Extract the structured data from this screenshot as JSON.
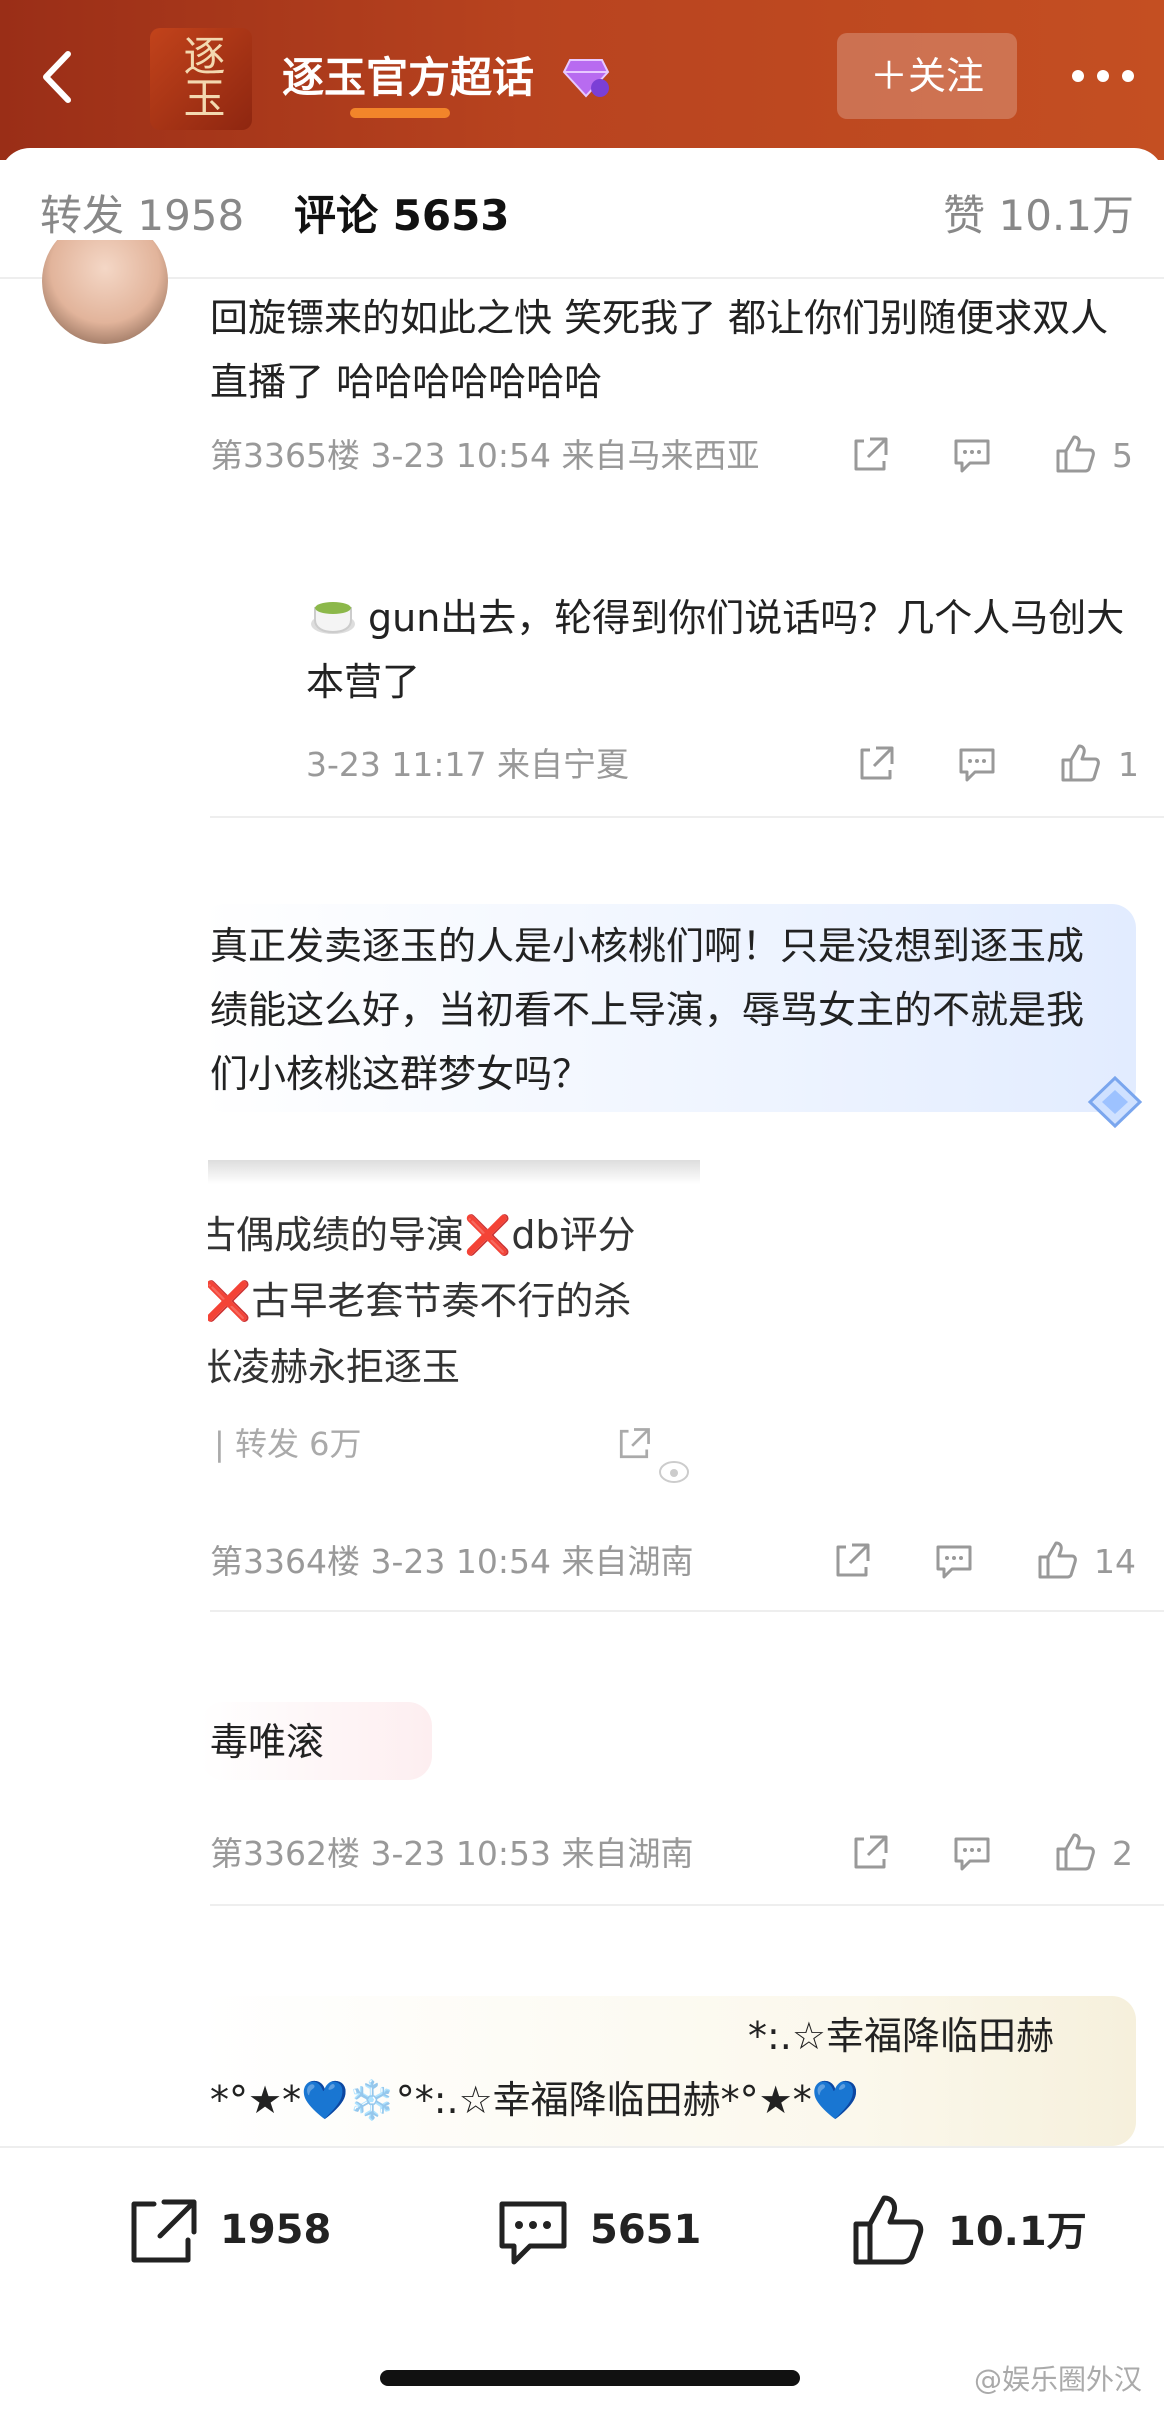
{
  "header": {
    "back_icon": "‹",
    "logo_text": "逐玉",
    "title": "逐玉官方超话",
    "follow_label": "＋关注",
    "more_icon": "•••"
  },
  "tabs": {
    "repost": "转发 1958",
    "comments": "评论 5653",
    "likes": "赞 10.1万"
  },
  "comments": [
    {
      "text": "回旋镖来的如此之快 笑死我了 都让你们别随便求双人直播了 哈哈哈哈哈哈哈",
      "meta": "第3365楼 3-23 10:54 来自马来西亚",
      "likes": "5"
    },
    {
      "text": "gun出去，轮得到你们说话吗？几个人马创大本营了",
      "meta": "3-23 11:17 来自宁夏",
      "likes": "1"
    },
    {
      "text": "真正发卖逐玉的人是小核桃们啊！只是没想到逐玉成绩能这么好，当初看不上导演，辱骂女主的不就是我们小核桃这群梦女吗？",
      "image_lines": [
        "古偶成绩的导演❌db评分",
        "❌古早老套节奏不行的杀",
        "张凌赫永拒逐玉"
      ],
      "image_repost": "| 转发 6万",
      "meta": "第3364楼 3-23 10:54 来自湖南",
      "likes": "14"
    },
    {
      "text": "毒唯滚",
      "meta": "第3362楼 3-23 10:53 来自湖南",
      "likes": "2"
    },
    {
      "text_line1": "*:.☆幸福降临田赫",
      "text_line2": "*°★*💙❄️°*:.☆幸福降临田赫*°★*💙"
    }
  ],
  "bottom_bar": {
    "repost_count": "1958",
    "comment_count": "5651",
    "like_count": "10.1万"
  },
  "watermark": "@娱乐圈外汉",
  "colors": {
    "header_bg": "#b8431f",
    "accent": "#f2852a",
    "meta": "#999999"
  }
}
